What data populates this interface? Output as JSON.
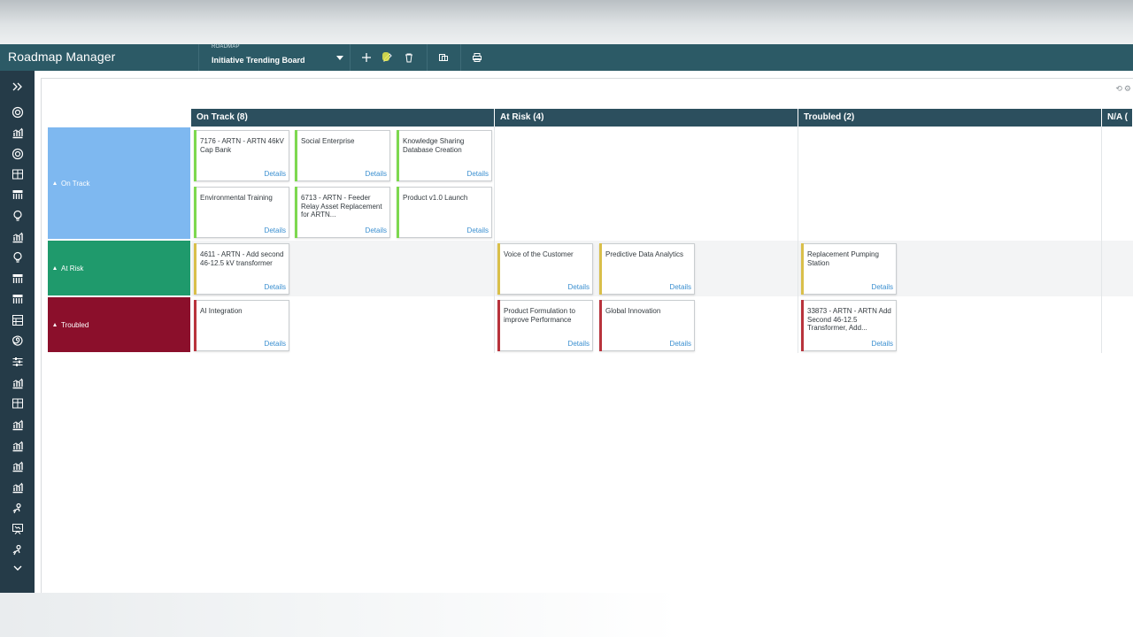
{
  "app": {
    "title": "Roadmap Manager",
    "roadmap_caption": "ROADMAP",
    "roadmap_value": "Initiative Trending Board"
  },
  "toolbar": {
    "add_icon": "plus-icon",
    "edit_icon": "pencil-icon",
    "delete_icon": "trash-icon",
    "copy_icon": "copy-icon",
    "print_icon": "print-icon"
  },
  "sidenav": {
    "items": [
      "expand-icon",
      "target-icon",
      "chart-icon",
      "target-icon",
      "grid-icon",
      "board-icon",
      "lightbulb-icon",
      "chart-icon",
      "lightbulb-icon",
      "board-icon",
      "board-icon",
      "table-icon",
      "spiral-icon",
      "sliders-icon",
      "chart-icon",
      "grid-icon",
      "chart-icon",
      "chart-icon",
      "chart-icon",
      "chart-icon",
      "person-icon",
      "presentation-icon",
      "person-icon",
      "chevron-down-icon"
    ]
  },
  "columns": [
    {
      "label": "On Track (8)"
    },
    {
      "label": "At Risk (4)"
    },
    {
      "label": "Troubled (2)"
    },
    {
      "label": "N/A ("
    }
  ],
  "rows": [
    {
      "label": "On Track",
      "color": "#7eb8f0"
    },
    {
      "label": "At Risk",
      "color": "#1f9a6c"
    },
    {
      "label": "Troubled",
      "color": "#8b0f2b"
    }
  ],
  "colors": {
    "green": "#7dd84f",
    "yellow": "#d9bf4a",
    "red": "#b8333c",
    "details_link": "#3a8fd0"
  },
  "details_label": "Details",
  "cards": [
    {
      "title": "7176 - ARTN - ARTN 46kV Cap Bank",
      "status": "green"
    },
    {
      "title": "Social Enterprise",
      "status": "green"
    },
    {
      "title": "Knowledge Sharing Database Creation",
      "status": "green"
    },
    {
      "title": "Environmental Training",
      "status": "green"
    },
    {
      "title": "6713 - ARTN - Feeder Relay Asset Replacement for ARTN...",
      "status": "green"
    },
    {
      "title": "Product v1.0 Launch",
      "status": "green"
    },
    {
      "title": "4611 - ARTN - Add second 46-12.5 kV transformer",
      "status": "yellow"
    },
    {
      "title": "Voice of the Customer",
      "status": "yellow"
    },
    {
      "title": "Predictive Data Analytics",
      "status": "yellow"
    },
    {
      "title": "Replacement Pumping Station",
      "status": "yellow"
    },
    {
      "title": "AI Integration",
      "status": "red"
    },
    {
      "title": "Product Formulation to improve Performance",
      "status": "red"
    },
    {
      "title": "Global Innovation",
      "status": "red"
    },
    {
      "title": "33873 - ARTN - ARTN Add Second 46-12.5 Transformer, Add...",
      "status": "red"
    }
  ]
}
